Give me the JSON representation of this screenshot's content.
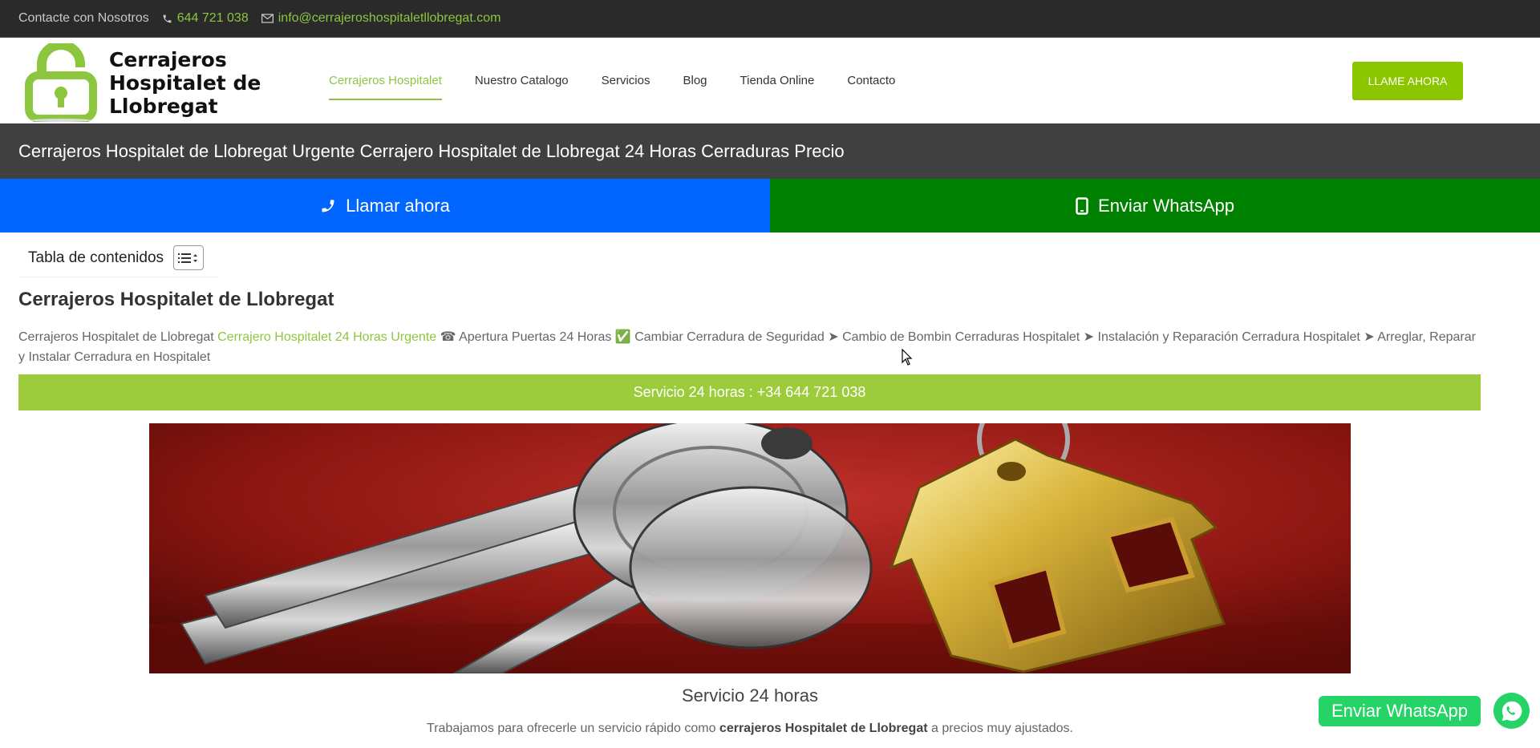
{
  "topbar": {
    "contact_text": "Contacte con Nosotros",
    "phone": "644 721 038",
    "email": "info@cerrajeroshospitaletllobregat.com"
  },
  "logo": {
    "text": "Cerrajeros Hospitalet de Llobregat",
    "icon": "padlock-icon"
  },
  "nav": {
    "items": [
      {
        "label": "Cerrajeros Hospitalet",
        "active": true
      },
      {
        "label": "Nuestro Catalogo",
        "active": false
      },
      {
        "label": "Servicios",
        "active": false
      },
      {
        "label": "Blog",
        "active": false
      },
      {
        "label": "Tienda Online",
        "active": false
      },
      {
        "label": "Contacto",
        "active": false
      }
    ],
    "cta_label": "LLAME AHORA"
  },
  "title_bar": {
    "title": "Cerrajeros Hospitalet de Llobregat Urgente Cerrajero Hospitalet de Llobregat 24 Horas Cerraduras Precio"
  },
  "callbar": {
    "call_label": "Llamar ahora",
    "whatsapp_label": "Enviar WhatsApp"
  },
  "toc": {
    "title": "Tabla de contenidos"
  },
  "content": {
    "heading": "Cerrajeros Hospitalet de Llobregat",
    "intro_prefix": "Cerrajeros Hospitalet de Llobregat ",
    "intro_link": "Cerrajero Hospitalet 24 Horas Urgente",
    "intro_rest": " ☎ Apertura Puertas 24 Horas ✅ Cambiar Cerradura de Seguridad ➤ Cambio de Bombin Cerraduras Hospitalet ➤ Instalación y Reparación Cerradura Hospitalet ➤ Arreglar, Reparar y Instalar Cerradura en Hospitalet",
    "service_bar": "Servicio 24 horas : +34 644 721 038",
    "caption": "Servicio 24 horas",
    "desc_prefix": "Trabajamos para ofrecerle un servicio rápido como ",
    "desc_bold": "cerrajeros Hospitalet de Llobregat",
    "desc_suffix": " a precios muy ajustados."
  },
  "floating": {
    "whatsapp_label": "Enviar WhatsApp"
  },
  "colors": {
    "accent_green": "#8cc63f",
    "call_blue": "#0066ff",
    "whatsapp_green": "#008000",
    "wa_float": "#25d366"
  }
}
